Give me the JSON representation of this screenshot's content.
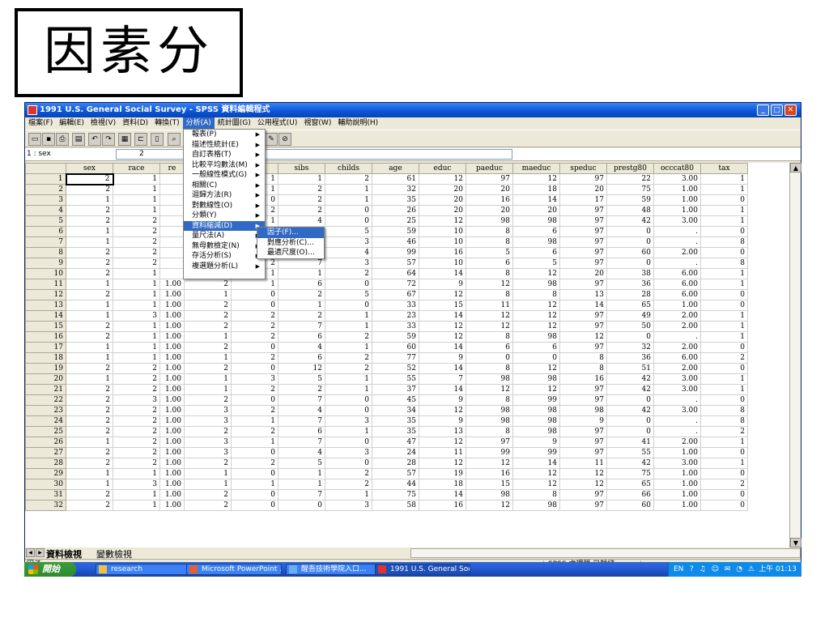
{
  "slide": {
    "title": "因素分析"
  },
  "window": {
    "title": "1991 U.S. General Social Survey - SPSS 資料編輯程式",
    "min": "_",
    "max": "□",
    "close": "✕"
  },
  "menubar": [
    "檔案(F)",
    "編輯(E)",
    "檢視(V)",
    "資料(D)",
    "轉換(T)",
    "分析(A)",
    "統計圖(G)",
    "公用程式(U)",
    "視窗(W)",
    "輔助說明(H)"
  ],
  "toolbar": [
    "open-icon",
    "save-icon",
    "print-icon",
    "dialog-recall-icon",
    "undo-icon",
    "redo-icon",
    "goto-chart-icon",
    "goto-case-icon",
    "variables-icon",
    "find-icon",
    "value-labels-icon",
    "use-sets-icon"
  ],
  "cellbar": {
    "ref": "1 : sex",
    "value": "2"
  },
  "columns": [
    "sex",
    "race",
    "re",
    "",
    "life",
    "sibs",
    "childs",
    "age",
    "educ",
    "paeduc",
    "maeduc",
    "speduc",
    "prestg80",
    "occcat80",
    "tax"
  ],
  "rows": [
    [
      "1",
      "2",
      "1",
      "",
      "",
      "1",
      "1",
      "2",
      "61",
      "12",
      "97",
      "12",
      "97",
      "22",
      "3.00",
      "1"
    ],
    [
      "2",
      "2",
      "1",
      "",
      "",
      "1",
      "2",
      "1",
      "32",
      "20",
      "20",
      "18",
      "20",
      "75",
      "1.00",
      "1"
    ],
    [
      "3",
      "1",
      "1",
      "",
      "",
      "0",
      "2",
      "1",
      "35",
      "20",
      "16",
      "14",
      "17",
      "59",
      "1.00",
      "0"
    ],
    [
      "4",
      "2",
      "1",
      "",
      "",
      "2",
      "2",
      "0",
      "26",
      "20",
      "20",
      "20",
      "97",
      "48",
      "1.00",
      "1"
    ],
    [
      "5",
      "2",
      "2",
      "",
      "",
      "1",
      "4",
      "0",
      "25",
      "12",
      "98",
      "98",
      "97",
      "42",
      "3.00",
      "1"
    ],
    [
      "6",
      "1",
      "2",
      "",
      "",
      "",
      "7",
      "5",
      "59",
      "10",
      "8",
      "6",
      "97",
      "0",
      ".",
      "0"
    ],
    [
      "7",
      "1",
      "2",
      "",
      "",
      "",
      "7",
      "3",
      "46",
      "10",
      "8",
      "98",
      "97",
      "0",
      ".",
      "8"
    ],
    [
      "8",
      "2",
      "2",
      "",
      "",
      "",
      "7",
      "4",
      "99",
      "16",
      "5",
      "6",
      "97",
      "60",
      "2.00",
      "0"
    ],
    [
      "9",
      "2",
      "2",
      "",
      "",
      "2",
      "7",
      "3",
      "57",
      "10",
      "6",
      "5",
      "97",
      "0",
      ".",
      "8"
    ],
    [
      "10",
      "2",
      "1",
      "",
      "2",
      "1",
      "1",
      "2",
      "64",
      "14",
      "8",
      "12",
      "20",
      "38",
      "6.00",
      "1"
    ],
    [
      "11",
      "1",
      "1",
      "1.00",
      "2",
      "1",
      "6",
      "0",
      "72",
      "9",
      "12",
      "98",
      "97",
      "36",
      "6.00",
      "1"
    ],
    [
      "12",
      "2",
      "1",
      "1.00",
      "1",
      "0",
      "2",
      "5",
      "67",
      "12",
      "8",
      "8",
      "13",
      "28",
      "6.00",
      "0"
    ],
    [
      "13",
      "1",
      "1",
      "1.00",
      "2",
      "0",
      "1",
      "0",
      "33",
      "15",
      "11",
      "12",
      "14",
      "65",
      "1.00",
      "0"
    ],
    [
      "14",
      "1",
      "3",
      "1.00",
      "2",
      "2",
      "2",
      "1",
      "23",
      "14",
      "12",
      "12",
      "97",
      "49",
      "2.00",
      "1"
    ],
    [
      "15",
      "2",
      "1",
      "1.00",
      "2",
      "2",
      "7",
      "1",
      "33",
      "12",
      "12",
      "12",
      "97",
      "50",
      "2.00",
      "1"
    ],
    [
      "16",
      "2",
      "1",
      "1.00",
      "1",
      "2",
      "6",
      "2",
      "59",
      "12",
      "8",
      "98",
      "12",
      "0",
      ".",
      "1"
    ],
    [
      "17",
      "1",
      "1",
      "1.00",
      "2",
      "0",
      "4",
      "1",
      "60",
      "14",
      "6",
      "6",
      "97",
      "32",
      "2.00",
      "0"
    ],
    [
      "18",
      "1",
      "1",
      "1.00",
      "1",
      "2",
      "6",
      "2",
      "77",
      "9",
      "0",
      "0",
      "8",
      "36",
      "6.00",
      "2"
    ],
    [
      "19",
      "2",
      "2",
      "1.00",
      "2",
      "0",
      "12",
      "2",
      "52",
      "14",
      "8",
      "12",
      "8",
      "51",
      "2.00",
      "0"
    ],
    [
      "20",
      "1",
      "2",
      "1.00",
      "1",
      "3",
      "5",
      "1",
      "55",
      "7",
      "98",
      "98",
      "16",
      "42",
      "3.00",
      "1"
    ],
    [
      "21",
      "2",
      "2",
      "1.00",
      "1",
      "2",
      "2",
      "1",
      "37",
      "14",
      "12",
      "12",
      "97",
      "42",
      "3.00",
      "1"
    ],
    [
      "22",
      "2",
      "3",
      "1.00",
      "2",
      "0",
      "7",
      "0",
      "45",
      "9",
      "8",
      "99",
      "97",
      "0",
      ".",
      "0"
    ],
    [
      "23",
      "2",
      "2",
      "1.00",
      "3",
      "2",
      "4",
      "0",
      "34",
      "12",
      "98",
      "98",
      "98",
      "42",
      "3.00",
      "8"
    ],
    [
      "24",
      "2",
      "2",
      "1.00",
      "3",
      "1",
      "7",
      "3",
      "35",
      "9",
      "98",
      "98",
      "9",
      "0",
      ".",
      "8"
    ],
    [
      "25",
      "2",
      "2",
      "1.00",
      "2",
      "2",
      "6",
      "1",
      "35",
      "13",
      "8",
      "98",
      "97",
      "0",
      ".",
      "2"
    ],
    [
      "26",
      "1",
      "2",
      "1.00",
      "3",
      "1",
      "7",
      "0",
      "47",
      "12",
      "97",
      "9",
      "97",
      "41",
      "2.00",
      "1"
    ],
    [
      "27",
      "2",
      "2",
      "1.00",
      "3",
      "0",
      "4",
      "3",
      "24",
      "11",
      "99",
      "99",
      "97",
      "55",
      "1.00",
      "0"
    ],
    [
      "28",
      "2",
      "2",
      "1.00",
      "2",
      "2",
      "5",
      "0",
      "28",
      "12",
      "12",
      "14",
      "11",
      "42",
      "3.00",
      "1"
    ],
    [
      "29",
      "1",
      "1",
      "1.00",
      "1",
      "0",
      "1",
      "2",
      "57",
      "19",
      "16",
      "12",
      "12",
      "75",
      "1.00",
      "0"
    ],
    [
      "30",
      "1",
      "3",
      "1.00",
      "1",
      "1",
      "1",
      "2",
      "44",
      "18",
      "15",
      "12",
      "12",
      "65",
      "1.00",
      "2"
    ],
    [
      "31",
      "2",
      "1",
      "1.00",
      "2",
      "0",
      "7",
      "1",
      "75",
      "14",
      "98",
      "8",
      "97",
      "66",
      "1.00",
      "0"
    ],
    [
      "32",
      "2",
      "1",
      "1.00",
      "2",
      "0",
      "0",
      "3",
      "58",
      "16",
      "12",
      "98",
      "97",
      "60",
      "1.00",
      "0"
    ]
  ],
  "analyze_menu": [
    "報表(P)",
    "描述性統計(E)",
    "自訂表格(T)",
    "比較平均數法(M)",
    "一般線性模式(G)",
    "相關(C)",
    "迴歸方法(R)",
    "對數線性(O)",
    "分類(Y)",
    "資料縮減(D)",
    "量尺法(A)",
    "無母數檢定(N)",
    "存活分析(S)",
    "複選題分析(L)"
  ],
  "analyze_menu_arrows": [
    true,
    true,
    true,
    true,
    true,
    true,
    true,
    true,
    true,
    true,
    true,
    true,
    true,
    true
  ],
  "data_reduction_submenu": [
    "因子(F)...",
    "對應分析(C)...",
    "最適尺度(O)..."
  ],
  "tabs": {
    "data_view": "資料檢視",
    "variable_view": "變數檢視"
  },
  "status": {
    "left": "因子",
    "right": "SPSS 處理器 已就緒"
  },
  "taskbar": {
    "start": "開始",
    "tasks": [
      "research",
      "Microsoft PowerPoint ...",
      "醒吾技術學院入口...",
      "1991 U.S. General Soc..."
    ],
    "lang": "EN",
    "tray_icons": "? ♫ ☺ ✉ ◔ ⚠",
    "clock": "上午 01:13"
  },
  "colors": {
    "titlebar": "#0a55d6",
    "highlight": "#316ac5",
    "taskbar": "#245edb",
    "start": "#3c9a3c"
  }
}
